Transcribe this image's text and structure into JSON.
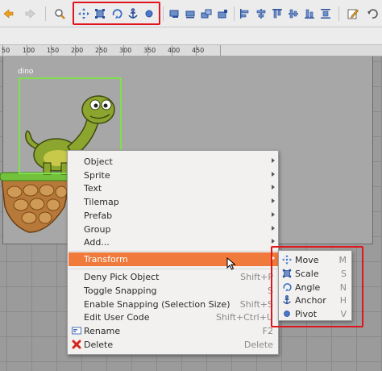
{
  "ruler": {
    "labels": [
      "50",
      "100",
      "150",
      "200",
      "250",
      "300",
      "350",
      "400",
      "450"
    ]
  },
  "sprite": {
    "name": "dino"
  },
  "toolbar": {
    "icons": [
      "back-icon",
      "forward-icon",
      "zoom-icon",
      "move-icon",
      "scale-icon",
      "angle-icon",
      "anchor-icon",
      "pivot-icon",
      "align-icons",
      "edit-icon"
    ]
  },
  "context_menu": {
    "groups": [
      {
        "label": "Object"
      },
      {
        "label": "Sprite"
      },
      {
        "label": "Text"
      },
      {
        "label": "Tilemap"
      },
      {
        "label": "Prefab"
      },
      {
        "label": "Group"
      },
      {
        "label": "Add..."
      }
    ],
    "transform": {
      "label": "Transform"
    },
    "deny_pick": {
      "label": "Deny Pick Object",
      "shortcut": "Shift+P"
    },
    "toggle_snapping": {
      "label": "Toggle Snapping",
      "shortcut": "S"
    },
    "enable_snapping": {
      "label": "Enable Snapping (Selection Size)",
      "shortcut": "Shift+S"
    },
    "edit_user_code": {
      "label": "Edit User Code",
      "shortcut": "Shift+Ctrl+U"
    },
    "rename": {
      "label": "Rename",
      "shortcut": "F2"
    },
    "delete": {
      "label": "Delete",
      "shortcut": "Delete"
    }
  },
  "transform_submenu": {
    "items": [
      {
        "label": "Move",
        "shortcut": "M",
        "icon": "move-icon"
      },
      {
        "label": "Scale",
        "shortcut": "S",
        "icon": "scale-icon"
      },
      {
        "label": "Angle",
        "shortcut": "N",
        "icon": "angle-icon"
      },
      {
        "label": "Anchor",
        "shortcut": "H",
        "icon": "anchor-icon"
      },
      {
        "label": "Pivot",
        "shortcut": "V",
        "icon": "pivot-icon"
      }
    ]
  },
  "colors": {
    "highlight_red": "#e0141d",
    "menu_active": "#ef7a3c",
    "selection_green": "#7ee04a",
    "icon_blue": "#3a6fc4"
  }
}
